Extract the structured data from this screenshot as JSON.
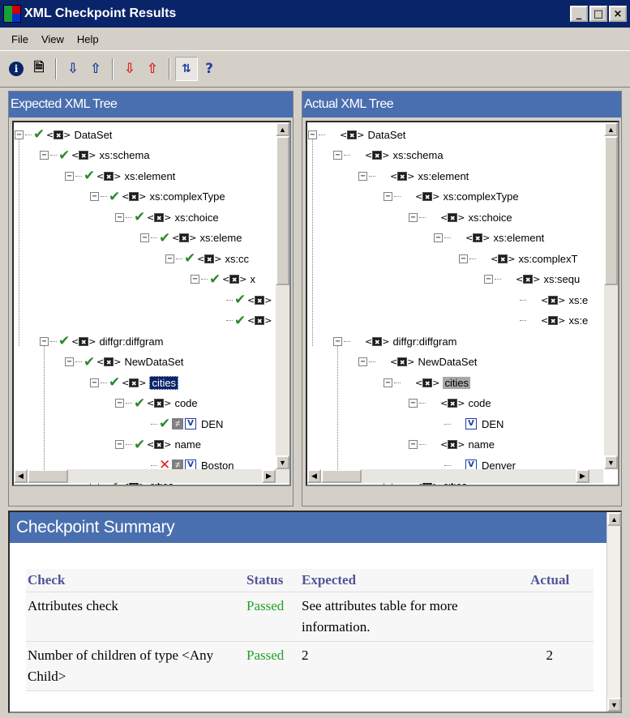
{
  "window": {
    "title": "XML Checkpoint Results"
  },
  "menu": [
    "File",
    "View",
    "Help"
  ],
  "toolbar": {
    "help_glyph": "?"
  },
  "expected_pane": {
    "header": "Expected XML Tree",
    "nodes": [
      {
        "label": "DataSet",
        "status": "check"
      },
      {
        "label": "xs:schema",
        "status": "check"
      },
      {
        "label": "xs:element",
        "status": "check"
      },
      {
        "label": "xs:complexType",
        "status": "check"
      },
      {
        "label": "xs:choice",
        "status": "check"
      },
      {
        "label": "xs:eleme",
        "status": "check"
      },
      {
        "label": "xs:cc",
        "status": "check"
      },
      {
        "label": "x",
        "status": "check"
      },
      {
        "label": "",
        "status": "check"
      },
      {
        "label": "",
        "status": "check"
      },
      {
        "label": "diffgr:diffgram",
        "status": "check"
      },
      {
        "label": "NewDataSet",
        "status": "check"
      },
      {
        "label": "cities",
        "status": "check"
      },
      {
        "label": "code",
        "status": "check"
      },
      {
        "label": "DEN",
        "status": "check"
      },
      {
        "label": "name",
        "status": "check"
      },
      {
        "label": "Boston",
        "status": "fail"
      },
      {
        "label": "cities",
        "status": "check"
      }
    ]
  },
  "actual_pane": {
    "header": "Actual XML Tree",
    "nodes": [
      {
        "label": "DataSet"
      },
      {
        "label": "xs:schema"
      },
      {
        "label": "xs:element"
      },
      {
        "label": "xs:complexType"
      },
      {
        "label": "xs:choice"
      },
      {
        "label": "xs:element"
      },
      {
        "label": "xs:complexT"
      },
      {
        "label": "xs:sequ"
      },
      {
        "label": "xs:e"
      },
      {
        "label": "xs:e"
      },
      {
        "label": "diffgr:diffgram"
      },
      {
        "label": "NewDataSet"
      },
      {
        "label": "cities"
      },
      {
        "label": "code"
      },
      {
        "label": "DEN"
      },
      {
        "label": "name"
      },
      {
        "label": "Denver"
      },
      {
        "label": "cities"
      }
    ]
  },
  "summary": {
    "header": "Checkpoint Summary",
    "columns": [
      "Check",
      "Status",
      "Expected",
      "Actual"
    ],
    "rows": [
      {
        "check": "Attributes check",
        "status": "Passed",
        "expected": "See attributes table for more information.",
        "actual": ""
      },
      {
        "check": "Number of children of type <Any Child>",
        "status": "Passed",
        "expected": "2",
        "actual": "2"
      }
    ]
  },
  "colors": {
    "title_bar": "#0a246a",
    "pane_header": "#4a6fb0",
    "check": "#2a8a2a",
    "fail": "#e02020",
    "passed": "#22a022",
    "table_header": "#53539a"
  }
}
